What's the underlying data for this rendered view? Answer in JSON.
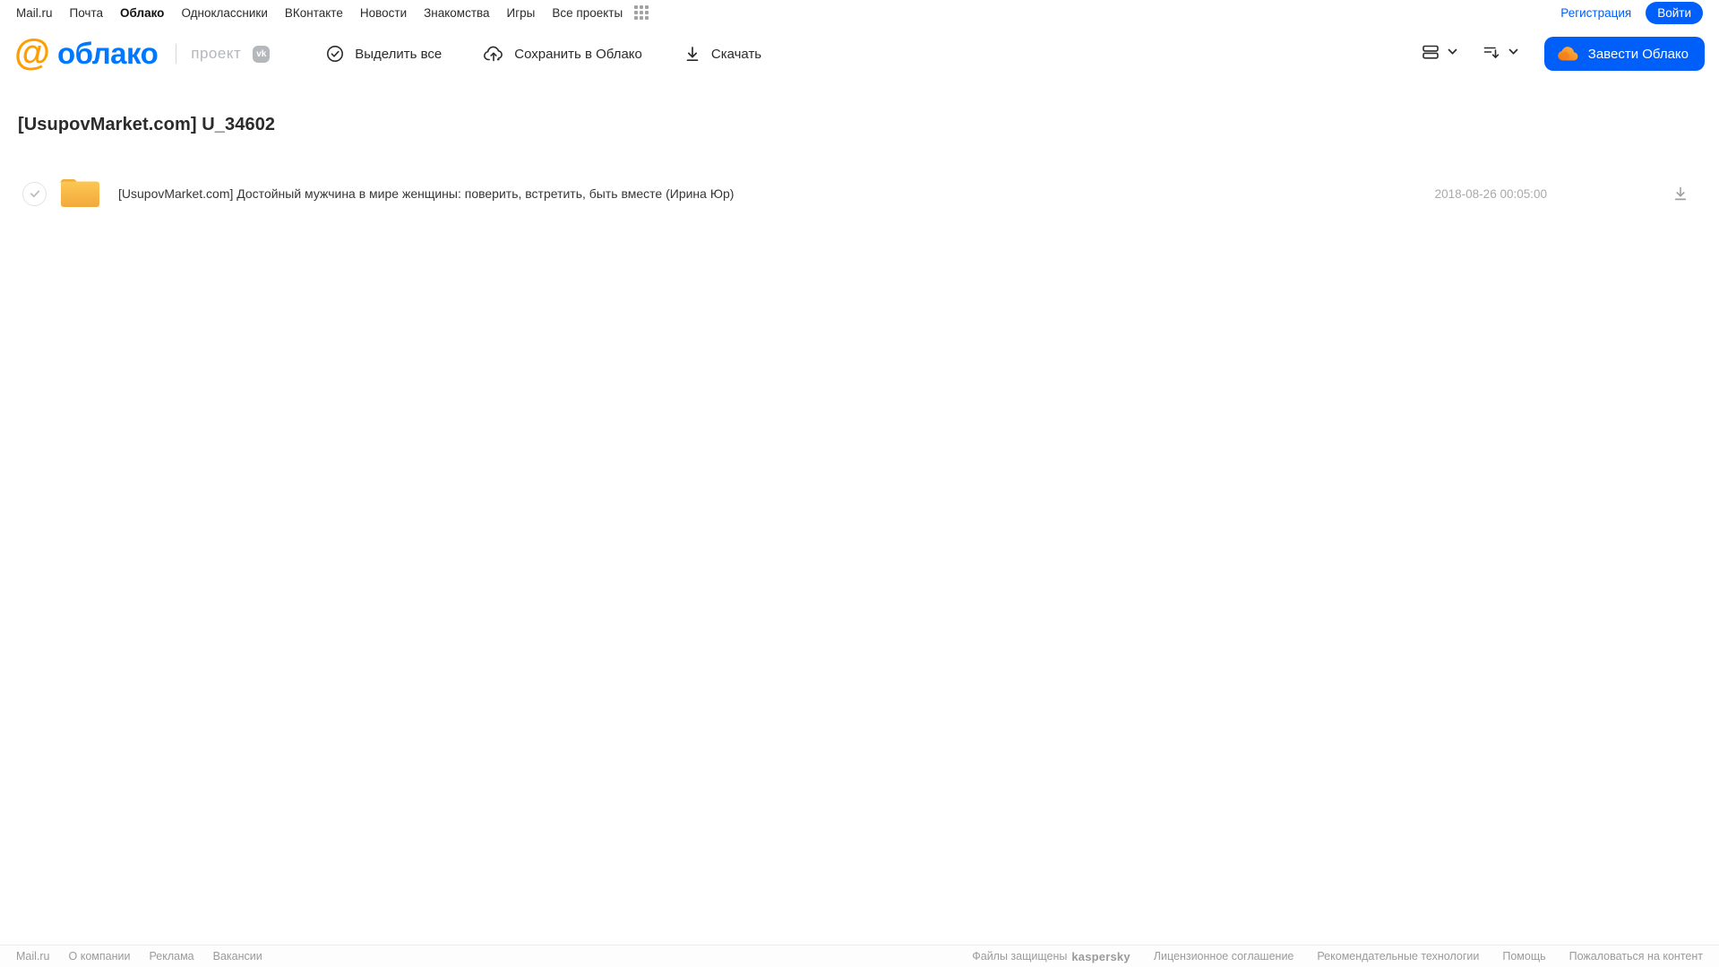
{
  "topnav": {
    "items": [
      {
        "label": "Mail.ru",
        "active": false
      },
      {
        "label": "Почта",
        "active": false
      },
      {
        "label": "Облако",
        "active": true
      },
      {
        "label": "Одноклассники",
        "active": false
      },
      {
        "label": "ВКонтакте",
        "active": false
      },
      {
        "label": "Новости",
        "active": false
      },
      {
        "label": "Знакомства",
        "active": false
      },
      {
        "label": "Игры",
        "active": false
      },
      {
        "label": "Все проекты",
        "active": false
      }
    ],
    "register_label": "Регистрация",
    "login_label": "Войти"
  },
  "header": {
    "logo_at": "@",
    "logo_text": "облако",
    "project_label": "проект",
    "vk_badge_text": "vk",
    "toolbar": {
      "select_all_label": "Выделить все",
      "save_to_cloud_label": "Сохранить в Облако",
      "download_label": "Скачать"
    },
    "cta_label": "Завести Облако"
  },
  "main": {
    "title": "[UsupovMarket.com] U_34602",
    "files": [
      {
        "type": "folder",
        "name": "[UsupovMarket.com] Достойный мужчина в мире женщины: поверить, встретить, быть вместе (Ирина Юр)",
        "date": "2018-08-26 00:05:00"
      }
    ]
  },
  "footer": {
    "left_links": [
      "Mail.ru",
      "О компании",
      "Реклама",
      "Вакансии"
    ],
    "protected_label": "Файлы защищены",
    "kaspersky_label": "kaspersky",
    "right_links": [
      "Лицензионное соглашение",
      "Рекомендательные технологии",
      "Помощь",
      "Пожаловаться на контент"
    ]
  },
  "colors": {
    "accent_blue": "#005ff9",
    "logo_blue": "#0077ff",
    "logo_orange": "#ff9e00",
    "folder_amber": "#f5b43c",
    "kaspersky_green": "#00a88e"
  }
}
